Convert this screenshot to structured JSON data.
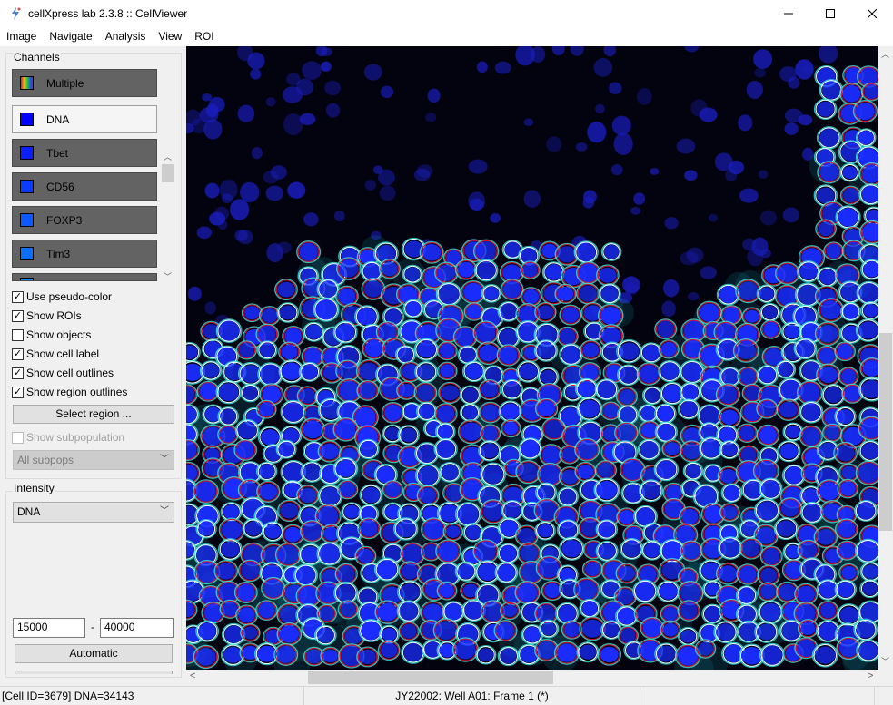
{
  "window": {
    "title": "cellXpress lab 2.3.8 :: CellViewer"
  },
  "menu": [
    "Image",
    "Navigate",
    "Analysis",
    "View",
    "ROI"
  ],
  "channels": {
    "label": "Channels",
    "items": [
      {
        "label": "Multiple",
        "swatch": "multicolor",
        "selected": false
      },
      {
        "label": "DNA",
        "swatch": "#0000ff",
        "selected": true
      },
      {
        "label": "Tbet",
        "swatch": "#0a1eff",
        "selected": false
      },
      {
        "label": "CD56",
        "swatch": "#0a3cff",
        "selected": false
      },
      {
        "label": "FOXP3",
        "swatch": "#0a5aff",
        "selected": false
      },
      {
        "label": "Tim3",
        "swatch": "#0a6eff",
        "selected": false
      }
    ]
  },
  "options": [
    {
      "label": "Use pseudo-color",
      "checked": true
    },
    {
      "label": "Show ROIs",
      "checked": true
    },
    {
      "label": "Show objects",
      "checked": false
    },
    {
      "label": "Show cell label",
      "checked": true
    },
    {
      "label": "Show cell outlines",
      "checked": true
    },
    {
      "label": "Show region outlines",
      "checked": true
    }
  ],
  "select_region_label": "Select region ...",
  "subpop": {
    "label": "Show subpopulation",
    "checked": false,
    "select_value": "All subpops"
  },
  "intensity": {
    "label": "Intensity",
    "channel": "DNA",
    "min": "15000",
    "separator": "-",
    "max": "40000",
    "auto_label": "Automatic"
  },
  "status": {
    "cell_info": "[Cell ID=3679]  DNA=34143",
    "location": "JY22002: Well A01: Frame 1 (*)"
  },
  "colors": {
    "nucleus": "#1a2cff",
    "membrane": "#37e8e0",
    "outline_region": "#ffffff",
    "outline_cell": "#e0102a"
  }
}
